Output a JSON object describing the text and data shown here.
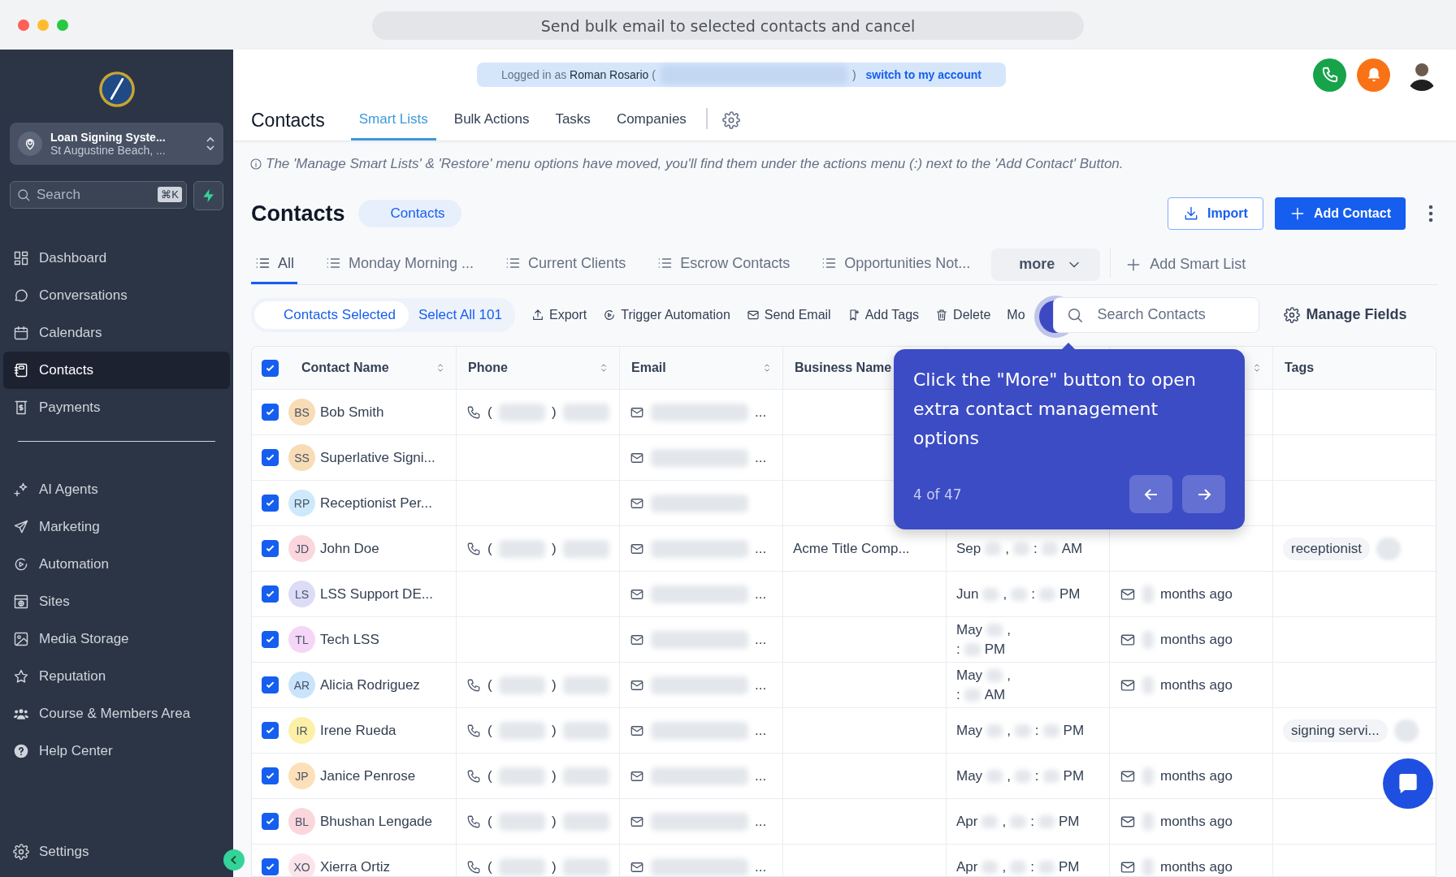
{
  "window": {
    "title": "Send bulk email to selected contacts and cancel"
  },
  "sidebar": {
    "account": {
      "name": "Loan Signing Syste...",
      "location": "St Augustine Beach, ..."
    },
    "search": {
      "placeholder": "Search",
      "shortcut": "⌘K"
    },
    "groups": [
      [
        {
          "label": "Dashboard",
          "kind": "dashboard",
          "selected": false
        },
        {
          "label": "Conversations",
          "kind": "chat",
          "selected": false
        },
        {
          "label": "Calendars",
          "kind": "calendar",
          "selected": false
        },
        {
          "label": "Contacts",
          "kind": "contacts",
          "selected": true
        },
        {
          "label": "Payments",
          "kind": "payments",
          "selected": false
        }
      ],
      [
        {
          "label": "AI Agents",
          "kind": "sparkle",
          "selected": false
        },
        {
          "label": "Marketing",
          "kind": "plane",
          "selected": false
        },
        {
          "label": "Automation",
          "kind": "play",
          "selected": false
        },
        {
          "label": "Sites",
          "kind": "site",
          "selected": false
        },
        {
          "label": "Media Storage",
          "kind": "image",
          "selected": false
        },
        {
          "label": "Reputation",
          "kind": "star",
          "selected": false
        },
        {
          "label": "Course & Members Area",
          "kind": "people",
          "selected": false
        },
        {
          "label": "Help Center",
          "kind": "help",
          "selected": false
        }
      ]
    ],
    "footer": {
      "label": "Settings",
      "kind": "gear",
      "selected": false
    }
  },
  "header": {
    "banner": {
      "text": "Logged in as **Roman Rosario** (",
      "close": ")",
      "link": "switch to my account"
    },
    "title": "Contacts",
    "tabs": [
      {
        "label": "Smart Lists",
        "selected": true
      },
      {
        "label": "Bulk Actions",
        "selected": false
      },
      {
        "label": "Tasks",
        "selected": false
      },
      {
        "label": "Companies",
        "selected": false
      }
    ]
  },
  "notice": "The 'Manage Smart Lists' & 'Restore' menu options have moved, you'll find them under the actions menu (:) next to the 'Add Contact' Button.",
  "page": {
    "title": "Contacts",
    "chip": "Contacts",
    "buttons": [
      {
        "label": "Import",
        "kind": "outline"
      },
      {
        "label": "Add Contact",
        "kind": "primary"
      }
    ]
  },
  "smart_lists": {
    "tabs": [
      {
        "label": "All",
        "selected": true
      },
      {
        "label": "Monday Morning ...",
        "selected": false
      },
      {
        "label": "Current Clients",
        "selected": false
      },
      {
        "label": "Escrow Contacts",
        "selected": false
      },
      {
        "label": "Opportunities Not...",
        "selected": false
      }
    ],
    "more": "more",
    "add": "Add Smart List"
  },
  "actions": {
    "selected": "Contacts Selected",
    "select_all": "Select All 101",
    "items": [
      {
        "label": "Export",
        "kind": "export"
      },
      {
        "label": "Trigger Automation",
        "kind": "play"
      },
      {
        "label": "Send Email",
        "kind": "mail"
      },
      {
        "label": "Add Tags",
        "kind": "tag"
      },
      {
        "label": "Delete",
        "kind": "trash"
      },
      {
        "label": "Mo",
        "kind": "more"
      }
    ],
    "search": {
      "placeholder": "Search Contacts"
    },
    "manage": "Manage Fields"
  },
  "tooltip": {
    "text": "Click the \"More\" button to open extra contact management options",
    "step": "4 of 47"
  },
  "table": {
    "all_checked": true,
    "columns": [
      {
        "label": "Contact Name",
        "sortable": true
      },
      {
        "label": "Phone",
        "sortable": true
      },
      {
        "label": "Email",
        "sortable": true
      },
      {
        "label": "Business Name"
      },
      {},
      {
        "sortable": true
      },
      {
        "label": "Tags"
      }
    ],
    "rows": [
      {
        "checked": true,
        "initials": "BS",
        "color": "#f7dcb5",
        "name": "Bob Smith",
        "phone": [
          "(",
          ")"
        ],
        "email": "..."
      },
      {
        "checked": true,
        "initials": "SS",
        "color": "#f7dcb5",
        "name": "Superlative Signi...",
        "email": "..."
      },
      {
        "checked": true,
        "initials": "RP",
        "color": "#cde9fb",
        "name": "Receptionist Per..."
      },
      {
        "checked": true,
        "initials": "JD",
        "color": "#fbd6dd",
        "name": "John Doe",
        "phone": [
          "(",
          ")"
        ],
        "email": "...",
        "business": "Acme Title Comp...",
        "date": [
          [
            "Sep",
            ",",
            ":",
            "AM"
          ]
        ],
        "tags": [
          "receptionist"
        ],
        "extra_tag_blurred": true
      },
      {
        "checked": true,
        "initials": "LS",
        "color": "#dcdcf7",
        "name": "LSS Support DE...",
        "email": "...",
        "date": [
          [
            "Jun",
            ",",
            ":",
            "PM"
          ]
        ],
        "activity": "months ago"
      },
      {
        "checked": true,
        "initials": "TL",
        "color": "#f5d6f6",
        "name": "Tech LSS",
        "email": "...",
        "date": [
          [
            "May",
            ","
          ],
          [
            ":",
            "PM"
          ]
        ],
        "activity": "months ago"
      },
      {
        "checked": true,
        "initials": "AR",
        "color": "#c9e4fb",
        "name": "Alicia Rodriguez",
        "phone": [
          "(",
          ")"
        ],
        "email": "...",
        "date": [
          [
            "May",
            ","
          ],
          [
            ":",
            "AM"
          ]
        ],
        "activity": "months ago"
      },
      {
        "checked": true,
        "initials": "IR",
        "color": "#fbf0a6",
        "name": "Irene Rueda",
        "phone": [
          "(",
          ")"
        ],
        "email": "...",
        "date": [
          [
            "May",
            ",",
            ":",
            "PM"
          ]
        ],
        "tags": [
          "signing servi..."
        ],
        "extra_tag_blurred": true
      },
      {
        "checked": true,
        "initials": "JP",
        "color": "#fde0b9",
        "name": "Janice Penrose",
        "phone": [
          "(",
          ")"
        ],
        "email": "...",
        "date": [
          [
            "May",
            ",",
            ":",
            "PM"
          ]
        ],
        "activity": "months ago"
      },
      {
        "checked": true,
        "initials": "BL",
        "color": "#fbd6dd",
        "name": "Bhushan Lengade",
        "phone": [
          "(",
          ")"
        ],
        "email": "...",
        "date": [
          [
            "Apr",
            ",",
            ":",
            "PM"
          ]
        ],
        "activity": "months ago"
      },
      {
        "checked": true,
        "initials": "XO",
        "color": "#fbe4ea",
        "name": "Xierra Ortiz",
        "phone": [
          "(",
          ")"
        ],
        "email": "...",
        "date": [
          [
            "Apr",
            ",",
            ":",
            "PM"
          ]
        ],
        "activity": "months ago"
      }
    ]
  }
}
